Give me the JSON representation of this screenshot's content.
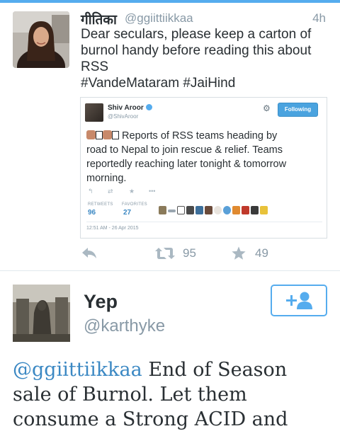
{
  "tweet1": {
    "author_name": "गीतिका",
    "author_handle": "@ggiittiikkaa",
    "time": "4h",
    "text_lines": [
      "Dear seculars, please keep a carton of",
      "burnol handy before reading this about",
      "RSS",
      "#VandeMataram #JaiHind"
    ],
    "embedded": {
      "author_name": "Shiv Aroor",
      "author_handle": "@ShivAroor",
      "follow_label": "Following",
      "text_line1_suffix": " Reports of RSS teams heading by",
      "text_lines": [
        "road to Nepal to join rescue & relief. Teams",
        "reportedly reaching later tonight & tomorrow",
        "morning."
      ],
      "retweets_label": "RETWEETS",
      "retweets_count": "96",
      "favorites_label": "FAVORITES",
      "favorites_count": "27",
      "date": "12:51 AM - 26 Apr 2015"
    },
    "retweet_count": "95",
    "favorite_count": "49"
  },
  "tweet2": {
    "author_name": "Yep",
    "author_handle": "@karthyke",
    "mention": "@ggiittiikkaa",
    "text_line1_rest": " End of Season",
    "text_lines": [
      "sale of Burnol. Let them",
      "consume a Strong ACID and"
    ]
  },
  "colors": {
    "accent": "#55acee",
    "link": "#3b88c3",
    "muted": "#8899a6"
  }
}
